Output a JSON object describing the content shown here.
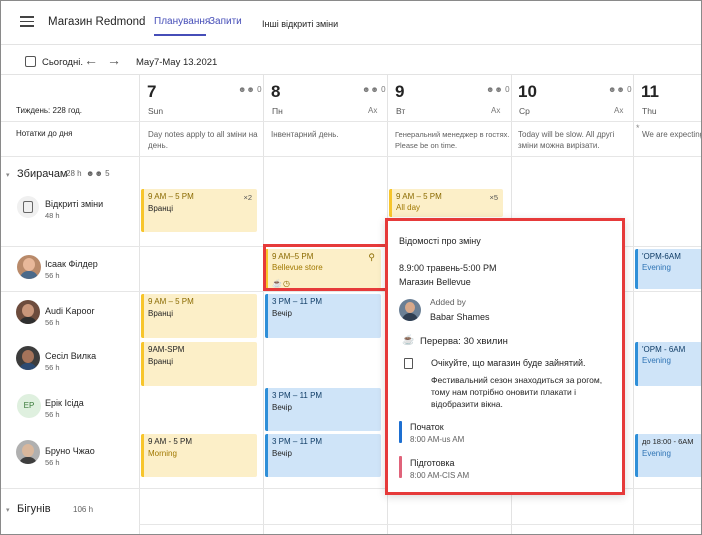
{
  "header": {
    "store_title": "Магазин Redmond",
    "tabs": [
      "Планування",
      "Запити",
      "Інші відкриті зміни"
    ]
  },
  "toolbar": {
    "today_label": "Сьогодні.",
    "prev_arrow": "←",
    "next_arrow": "→",
    "date_range": "May7-May 13.2021"
  },
  "side": {
    "week_label": "Тиждень: 228 год.",
    "notes_label": "Нотатки до дня"
  },
  "days": [
    {
      "num": "7",
      "name": "Sun",
      "people": "0",
      "note": "Day notes apply to all зміни на день."
    },
    {
      "num": "8",
      "name": "Пн",
      "right": "Ax",
      "note": "Інвентарний день."
    },
    {
      "num": "9",
      "name": "Вт",
      "right": "Ax",
      "note": "Генеральний менеджер в гостях. Please be on time."
    },
    {
      "num": "10",
      "name": "Ср",
      "right": "Ax",
      "note": "Today will be slow. All другі зміни можна вирізати."
    },
    {
      "num": "11",
      "name": "Thu",
      "note": "We are expecting будьте зайняті."
    }
  ],
  "groups": [
    {
      "title": "Збирачам",
      "hours": "28 h",
      "people": "5"
    },
    {
      "title": "Бігунів",
      "hours": "106 h"
    }
  ],
  "open_shifts": {
    "label": "Відкриті зміни",
    "hours": "48 h"
  },
  "people": [
    {
      "name": "Ісаак Філдер",
      "hours": "56 h"
    },
    {
      "name": "Audi Kapoor",
      "hours": "56 h"
    },
    {
      "name": "Сесіл Вилка",
      "hours": "56 h"
    },
    {
      "name": "Ерік Ісіда",
      "hours": "56 h",
      "initials": "EP"
    },
    {
      "name": "Бруно Чжао",
      "hours": "56 h"
    }
  ],
  "shifts": {
    "open_sun": {
      "time": "9 AM – 5 PM",
      "sub": "Вранці",
      "badge": "×2"
    },
    "open_tue": {
      "time": "9 AM – 5 PM",
      "sub": "All day",
      "badge": "×5"
    },
    "isaac_mon": {
      "time": "9 AM–5 PM",
      "sub": "Bellevue store"
    },
    "isaac_thu": {
      "time": "'OPM-6AM",
      "sub": "Evening"
    },
    "audi_sun": {
      "time": "9 AM – 5 PM",
      "sub": "Вранці"
    },
    "audi_mon": {
      "time": "3 PM – 11 PM",
      "sub": "Вечір"
    },
    "cecil_sun": {
      "time": "9AM-SPM",
      "sub": "Вранці"
    },
    "cecil_thu": {
      "time": "'OPM - 6AM",
      "sub": "Evening"
    },
    "eric_mon": {
      "time": "3 PM – 11 PM",
      "sub": "Вечір"
    },
    "bruno_sun": {
      "time": "9 AM - 5 PM",
      "sub": "Morning"
    },
    "bruno_mon": {
      "time": "3 PM – 11 PM",
      "sub": "Вечір"
    },
    "bruno_thu": {
      "time": "до 18:00 - 6AM",
      "sub": "Evening"
    }
  },
  "popup": {
    "title": "Відомості про зміну",
    "time": "8.9:00 травень-5:00 PM",
    "store": "Магазин Bellevue",
    "added_by_label": "Added by",
    "author": "Babar Shames",
    "break": "Перерва: 30 хвилин",
    "note_line1": "Очікуйте, що магазин буде зайнятий.",
    "note_line2": "Фестивальний сезон знаходиться за рогом, тому нам потрібно оновити плакати і відобразити вікна.",
    "activities": [
      {
        "name": "Початок",
        "time": "8:00 AM-us AM",
        "color": "#1d6fd1"
      },
      {
        "name": "Підготовка",
        "time": "8:00 AM-CIS AM",
        "color": "#e0637a"
      }
    ]
  },
  "colors": {
    "accent": "#464eb8",
    "highlight": "#e63a3a"
  }
}
